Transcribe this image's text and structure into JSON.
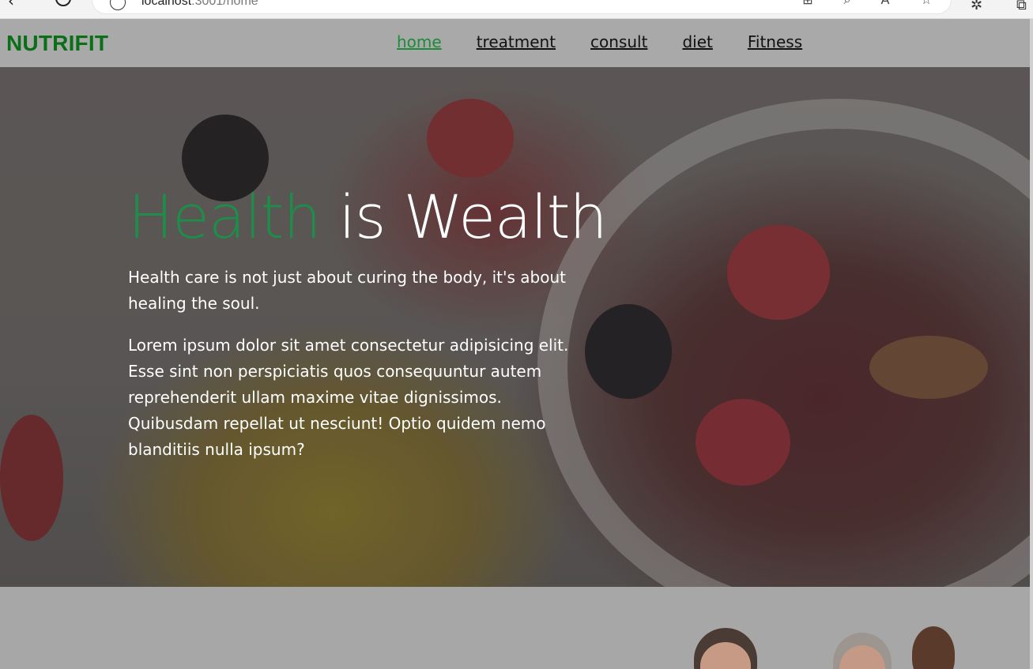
{
  "browser": {
    "url_host": "localhost",
    "url_rest": ":3001/home"
  },
  "brand": "NUTRIFIT",
  "nav": {
    "items": [
      "home",
      "treatment",
      "consult",
      "diet",
      "Fitness"
    ],
    "active": "home"
  },
  "hero": {
    "title_accent": "Health",
    "title_rest": " is Wealth",
    "subtitle": "Health care is not just about curing the body, it's about healing the soul.",
    "body": "Lorem ipsum dolor sit amet consectetur adipisicing elit. Esse sint non perspiciatis quos consequuntur autem reprehenderit ullam maxime vitae dignissimos. Quibusdam repellat ut nesciunt! Optio quidem nemo blanditiis nulla ipsum?"
  },
  "colors": {
    "brand": "#0b6f18",
    "accent": "#1f8c4a",
    "navbar": "#a9a9a9"
  }
}
